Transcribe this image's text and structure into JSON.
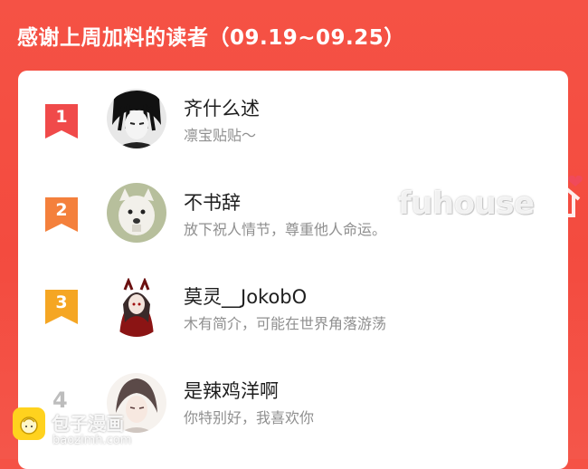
{
  "header": {
    "title": "感谢上周加料的读者（09.19~09.25）"
  },
  "readers": [
    {
      "rank": "1",
      "name": "齐什么述",
      "bio": "凛宝贴贴～",
      "badge_color": "#f04a4a"
    },
    {
      "rank": "2",
      "name": "不书辞",
      "bio": "放下祝人情节，尊重他人命运。",
      "badge_color": "#f4803c"
    },
    {
      "rank": "3",
      "name": "莫灵__JokobO",
      "bio": "木有简介，可能在世界角落游荡",
      "badge_color": "#f5a623"
    },
    {
      "rank": "4",
      "name": "是辣鸡洋啊",
      "bio": "你特别好，我喜欢你"
    }
  ],
  "watermarks": {
    "fuhouse": "fuhouse",
    "baozi_name": "包子漫画",
    "baozi_url": "baozimh.com"
  },
  "colors": {
    "background": "#f34b3f",
    "card": "#ffffff"
  }
}
